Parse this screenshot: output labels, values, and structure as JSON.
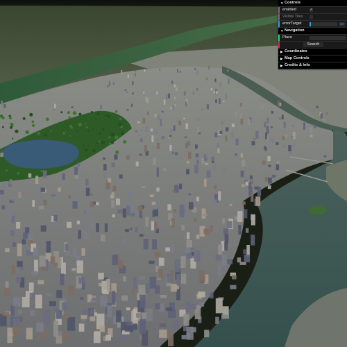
{
  "controls": {
    "title": "Controls",
    "enabled": {
      "label": "enabled",
      "checked": true
    },
    "visible_tiles": {
      "label": "Visible Tiles",
      "checked": false
    },
    "error_target": {
      "label": "errorTarget",
      "value": "10",
      "fraction": 0.04
    }
  },
  "navigation": {
    "title": "Navigation",
    "place": {
      "label": "Place",
      "value": ""
    },
    "search_label": "Search"
  },
  "folders": [
    {
      "title": "Coordinates"
    },
    {
      "title": "Map Controls"
    },
    {
      "title": "Credits & Info"
    }
  ],
  "icons": {
    "expanded": "triangle-down-icon",
    "collapsed": "triangle-right-icon",
    "check": "check-icon"
  },
  "colors": {
    "panel_bg": "#1a1a1a",
    "title_bg": "#000000",
    "accent_number": "#2fa1d6",
    "accent_boolean": "#806787",
    "accent_string": "#1ed36f",
    "accent_function": "#e61d5f",
    "water": "#3f5a55",
    "reservoir": "#3a5b77",
    "park": "#2d5a26"
  }
}
